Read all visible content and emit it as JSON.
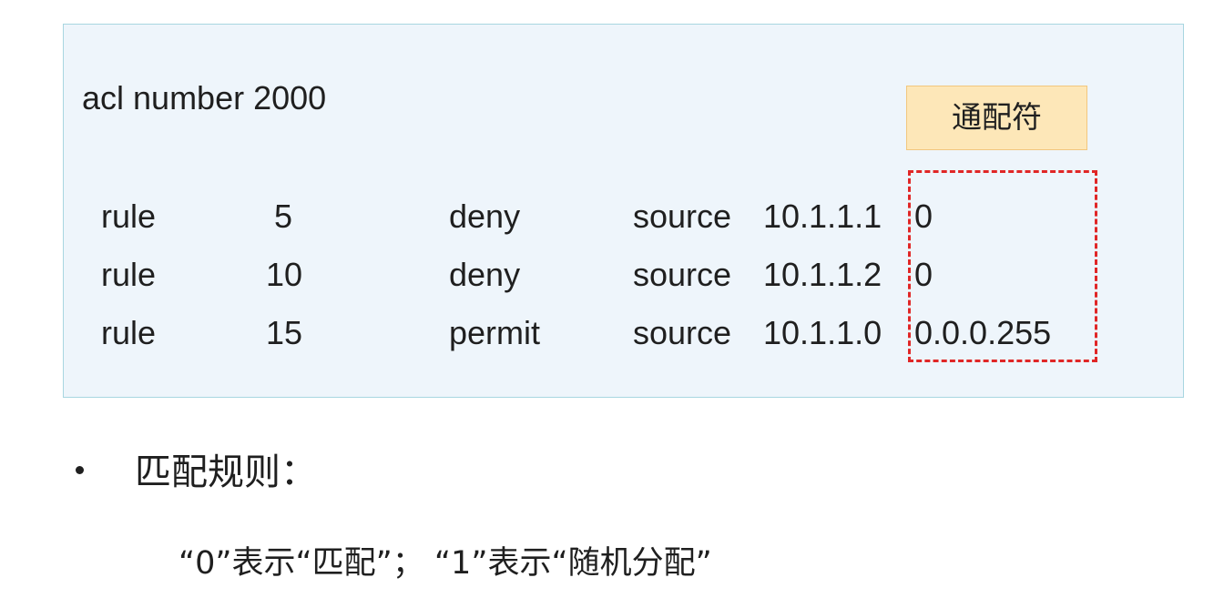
{
  "acl": {
    "header": "acl number 2000",
    "wildcard_label": "通配符",
    "rules": [
      {
        "keyword": "rule",
        "number": "5",
        "action": "deny",
        "source_keyword": "source",
        "ip": "10.1.1.1",
        "wildcard": "0"
      },
      {
        "keyword": "rule",
        "number": "10",
        "action": "deny",
        "source_keyword": "source",
        "ip": "10.1.1.2",
        "wildcard": "0"
      },
      {
        "keyword": "rule",
        "number": "15",
        "action": "permit",
        "source_keyword": "source",
        "ip": "10.1.1.0",
        "wildcard": "0.0.0.255"
      }
    ]
  },
  "bullet": {
    "text": "匹配规则："
  },
  "explanation": "“0”表示“匹配”；  “1”表示“随机分配”",
  "colors": {
    "box_background": "#eef5fb",
    "box_border": "#a8d6e0",
    "label_background": "#fde7b8",
    "dashed_outline": "#e02626"
  }
}
